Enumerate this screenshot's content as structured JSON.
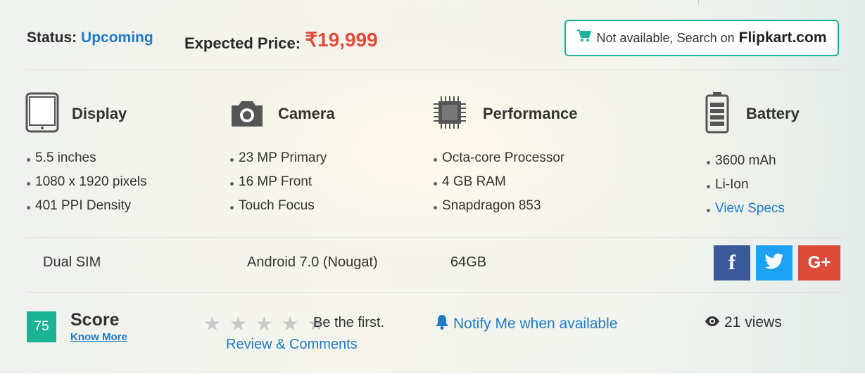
{
  "status": {
    "label": "Status:",
    "value": "Upcoming"
  },
  "price": {
    "label": "Expected Price:",
    "currency": "₹",
    "value": "19,999"
  },
  "flipkart": {
    "text": "Not available, Search on",
    "brand": "Flipkart.com",
    "icon": "cart-icon"
  },
  "specs": {
    "display": {
      "title": "Display",
      "icon": "tablet-icon",
      "items": [
        "5.5 inches",
        "1080 x 1920 pixels",
        "401 PPI Density"
      ]
    },
    "camera": {
      "title": "Camera",
      "icon": "camera-icon",
      "items": [
        "23 MP Primary",
        "16 MP Front",
        "Touch Focus"
      ]
    },
    "performance": {
      "title": "Performance",
      "icon": "chip-icon",
      "items": [
        "Octa-core Processor",
        "4 GB RAM",
        "Snapdragon 853"
      ]
    },
    "battery": {
      "title": "Battery",
      "icon": "battery-icon",
      "items": [
        "3600 mAh",
        "Li-Ion"
      ],
      "link": "View Specs"
    }
  },
  "extras": {
    "sim": "Dual SIM",
    "os": "Android 7.0 (Nougat)",
    "storage": "64GB"
  },
  "social": {
    "facebook": "f",
    "twitter": "twitter-bird",
    "google": "G+"
  },
  "score": {
    "value": "75",
    "title": "Score",
    "link": "Know More"
  },
  "rating": {
    "stars": "★ ★ ★ ★ ★",
    "prompt": "Be the first.",
    "link": "Review & Comments"
  },
  "notify": {
    "text": "Notify Me when available",
    "icon": "bell-icon"
  },
  "views": {
    "text": "21 views",
    "icon": "eye-icon"
  },
  "colors": {
    "accent": "#1bb39a",
    "link": "#1f7bc8",
    "price": "#e24a3b",
    "facebook": "#3b5998",
    "twitter": "#1da1f2",
    "google": "#dd4b39"
  }
}
